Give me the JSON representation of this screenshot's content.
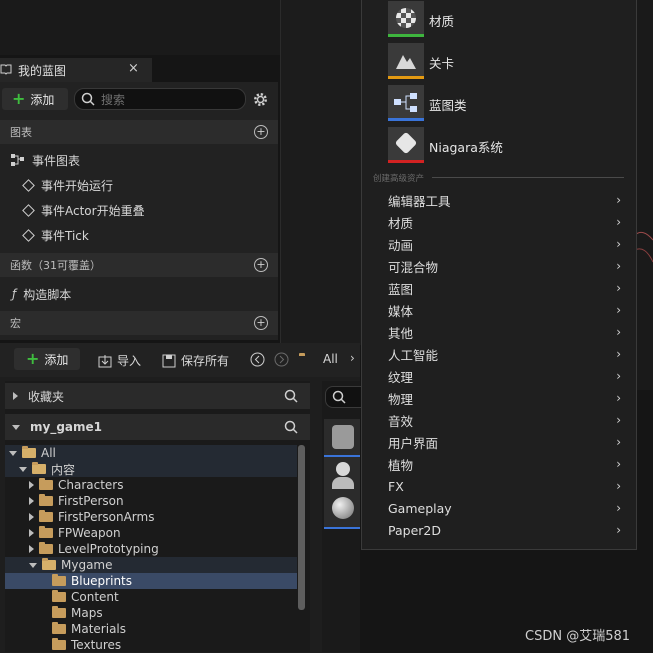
{
  "my_blueprint": {
    "tab_title": "我的蓝图",
    "close": "×",
    "add_label": "添加",
    "search_placeholder": "搜索",
    "sections": {
      "graphs": "图表",
      "event_graph": "事件图表",
      "events": [
        "事件开始运行",
        "事件Actor开始重叠",
        "事件Tick"
      ],
      "functions": "函数（31可覆盖）",
      "construction_script": "构造脚本",
      "macros": "宏"
    }
  },
  "content_browser": {
    "add_label": "添加",
    "import_label": "导入",
    "save_all_label": "保存所有",
    "path_label": "All",
    "favorites": "收藏夹",
    "project": "my_game1",
    "tree": [
      {
        "label": "All",
        "level": 0,
        "open": true
      },
      {
        "label": "内容",
        "level": 1,
        "open": true
      },
      {
        "label": "Characters",
        "level": 2
      },
      {
        "label": "FirstPerson",
        "level": 2
      },
      {
        "label": "FirstPersonArms",
        "level": 2
      },
      {
        "label": "FPWeapon",
        "level": 2
      },
      {
        "label": "LevelPrototyping",
        "level": 2
      },
      {
        "label": "Mygame",
        "level": 2,
        "open": true
      },
      {
        "label": "Blueprints",
        "level": 3,
        "selected": true
      },
      {
        "label": "Content",
        "level": 3
      },
      {
        "label": "Maps",
        "level": 3
      },
      {
        "label": "Materials",
        "level": 3
      },
      {
        "label": "Textures",
        "level": 3
      }
    ]
  },
  "menu": {
    "basic_assets": [
      {
        "label": "材质",
        "color": "#3eb53e"
      },
      {
        "label": "关卡",
        "color": "#e49a12"
      },
      {
        "label": "蓝图类",
        "color": "#3a74d9"
      },
      {
        "label": "Niagara系统",
        "color": "#d22222"
      }
    ],
    "advanced_header": "创建高级资产",
    "categories": [
      "编辑器工具",
      "材质",
      "动画",
      "可混合物",
      "蓝图",
      "媒体",
      "其他",
      "人工智能",
      "纹理",
      "物理",
      "音效",
      "用户界面",
      "植物",
      "FX",
      "Gameplay",
      "Paper2D"
    ]
  },
  "watermark": "CSDN @艾瑞581"
}
